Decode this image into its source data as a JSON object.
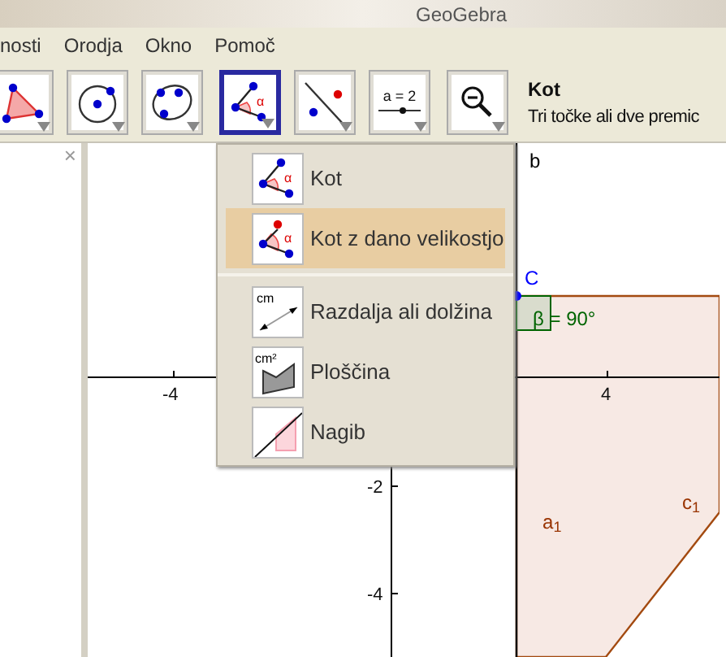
{
  "window": {
    "title": "GeoGebra"
  },
  "menu_bar": [
    {
      "label": "nosti"
    },
    {
      "label": "Orodja"
    },
    {
      "label": "Okno"
    },
    {
      "label": "Pomoč"
    }
  ],
  "toolbar": {
    "groups": [
      [
        {
          "kind": "polygon",
          "selected": false
        },
        {
          "kind": "circle",
          "selected": false
        },
        {
          "kind": "conic",
          "selected": false
        }
      ],
      [
        {
          "kind": "angle",
          "icon_text": "α",
          "selected": true
        },
        {
          "kind": "line-point",
          "selected": false
        },
        {
          "kind": "slider",
          "label": "a = 2",
          "selected": false
        }
      ],
      [
        {
          "kind": "zoom",
          "selected": false
        }
      ]
    ],
    "help": {
      "title": "Kot",
      "text": "Tri točke ali dve premic"
    }
  },
  "algebra_view": {
    "close": "×"
  },
  "graphics": {
    "x_ticks": [
      "-4",
      "4"
    ],
    "y_ticks": [
      "-2",
      "-4"
    ],
    "labels": [
      {
        "text": "b",
        "color": "#000000"
      },
      {
        "text": "C",
        "color": "#0000ff"
      },
      {
        "text": "β = 90°",
        "color": "#006400"
      },
      {
        "text": "a$_{1}$",
        "color": "#993300"
      },
      {
        "text": "c$_{1}$",
        "color": "#993300"
      }
    ]
  },
  "dropdown": {
    "groups": [
      [
        {
          "label": "Kot",
          "kind": "angle",
          "icon_text": "α",
          "selected": false
        },
        {
          "label": "Kot z dano velikostjo",
          "kind": "angle-fixed",
          "icon_text": "α",
          "selected": true
        }
      ],
      [
        {
          "label": "Razdalja ali dolžina",
          "kind": "distance",
          "icon_text": "cm",
          "selected": false
        },
        {
          "label": "Ploščina",
          "kind": "area",
          "icon_text": "cm²",
          "selected": false
        },
        {
          "label": "Nagib",
          "kind": "slope",
          "selected": false
        }
      ]
    ]
  }
}
